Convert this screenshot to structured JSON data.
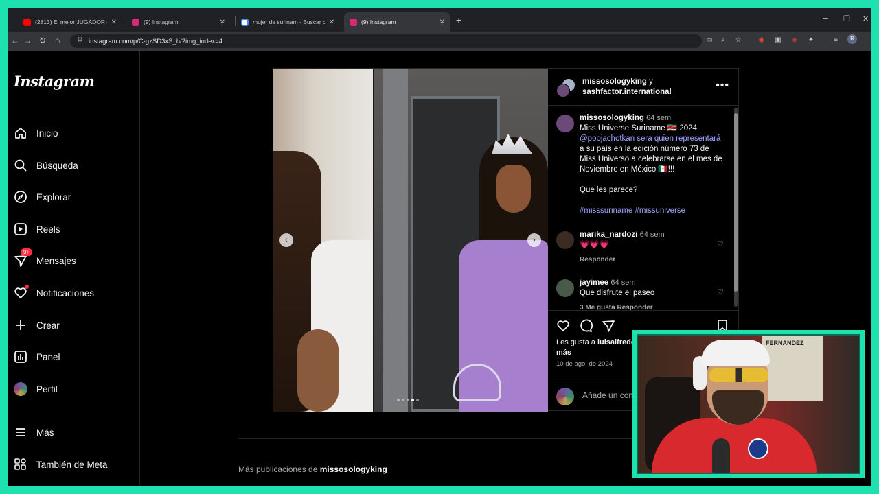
{
  "browser": {
    "tabs": [
      {
        "title": "(2813) El mejor JUGADOR de c…",
        "fav_color": "#ff0000",
        "active": false
      },
      {
        "title": "(9) Instagram",
        "fav_color": "#d62976",
        "active": false
      },
      {
        "title": "mujer de surinam - Buscar con…",
        "fav_color": "#4285f4",
        "active": false
      },
      {
        "title": "(9) Instagram",
        "fav_color": "#d62976",
        "active": true
      }
    ],
    "url": "instagram.com/p/C-gzSD3xS_h/?img_index=4",
    "profile_initial": "R"
  },
  "sidebar": {
    "logo": "Instagram",
    "items": [
      {
        "label": "Inicio",
        "icon": "home-icon"
      },
      {
        "label": "Búsqueda",
        "icon": "search-icon"
      },
      {
        "label": "Explorar",
        "icon": "compass-icon"
      },
      {
        "label": "Reels",
        "icon": "reels-icon"
      },
      {
        "label": "Mensajes",
        "icon": "messages-icon",
        "badge": "9+"
      },
      {
        "label": "Notificaciones",
        "icon": "heart-icon"
      },
      {
        "label": "Crear",
        "icon": "plus-icon"
      },
      {
        "label": "Panel",
        "icon": "dashboard-icon"
      },
      {
        "label": "Perfil",
        "icon": "avatar"
      },
      {
        "label": "Más",
        "icon": "menu-icon"
      },
      {
        "label": "También de Meta",
        "icon": "meta-icon"
      }
    ]
  },
  "post": {
    "header": {
      "user1": "missosologyking",
      "conj": "y",
      "user2": "sashfactor.international"
    },
    "caption": {
      "user": "missosologyking",
      "time": "64 sem",
      "lines": [
        "Miss Universe Suriname 🇸🇷 2024",
        "@poojachotkan sera quien representará",
        "a su país en la edición número 73 de",
        "Miss Universo a celebrarse en el mes de",
        "Noviembre en México 🇲🇽!!!",
        "",
        "Que les parece?",
        "",
        "#misssuriname #missuniverse"
      ]
    },
    "comments": [
      {
        "user": "marika_nardozi",
        "time": "64 sem",
        "text": "💗💗💗",
        "meta": "Responder"
      },
      {
        "user": "jayimee",
        "time": "64 sem",
        "text": "Que disfrute el paseo",
        "meta": "3 Me gusta   Responder"
      }
    ],
    "likes_prefix": "Les gusta a",
    "likes_user": "luisalfredo",
    "likes_more": "más",
    "date": "10 de ago. de 2024",
    "add_comment_placeholder": "Añade un comentario...",
    "carousel_active_index": 4,
    "carousel_count": 5
  },
  "more_posts": {
    "prefix": "Más publicaciones de",
    "user": "missosologyking"
  },
  "webcam": {
    "poster_text": "FERNANDEZ"
  },
  "colors": {
    "accent_frame": "#1de2b0",
    "badge": "#ff3040",
    "link": "#a0a8ff"
  }
}
